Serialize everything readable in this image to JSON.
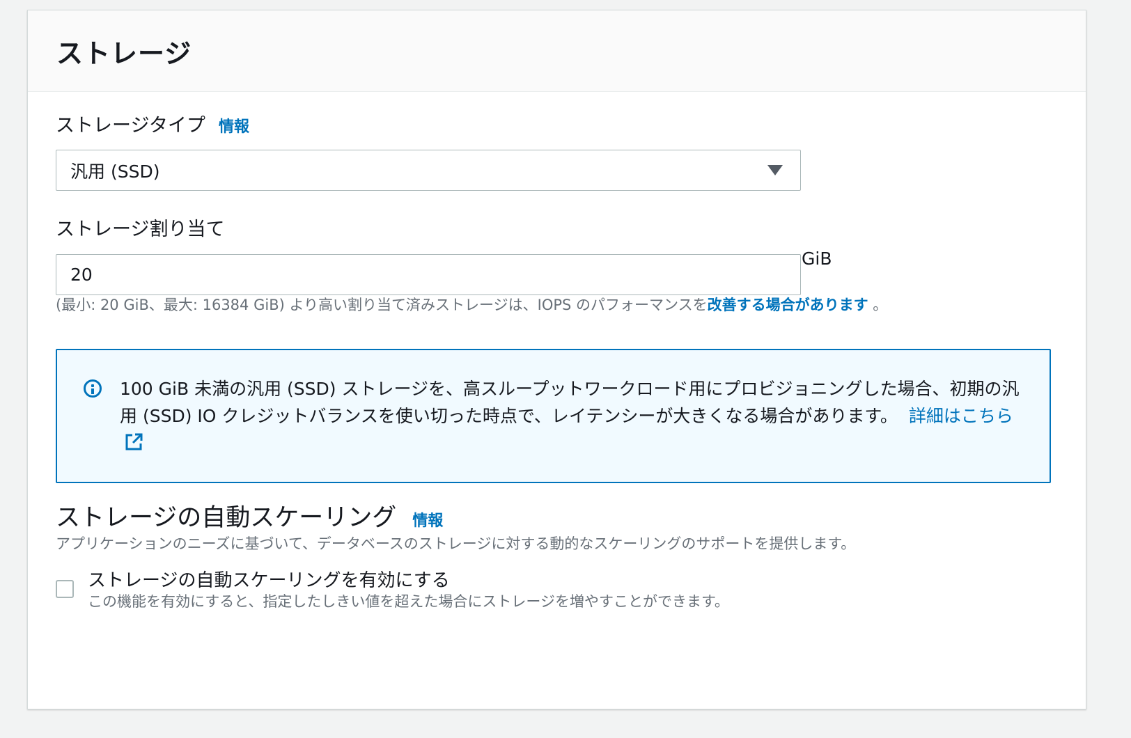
{
  "panel": {
    "title": "ストレージ"
  },
  "storage_type": {
    "label": "ストレージタイプ",
    "info_link": "情報",
    "selected_value": "汎用 (SSD)",
    "caret_icon": "caret-down-icon"
  },
  "allocation": {
    "label": "ストレージ割り当て",
    "value": "20",
    "unit": "GiB",
    "hint_prefix": "(最小: 20 GiB、最大: 16384 GiB) より高い割り当て済みストレージは、IOPS のパフォーマンスを",
    "hint_link": "改善する場合があります",
    "hint_suffix": " 。"
  },
  "alert": {
    "icon": "info-circle-icon",
    "text": "100 GiB 未満の汎用 (SSD) ストレージを、高スループットワークロード用にプロビジョニングした場合、初期の汎用 (SSD) IO クレジットバランスを使い切った時点で、レイテンシーが大きくなる場合があります。",
    "link_label": "詳細はこちら",
    "link_icon": "external-link-icon",
    "color": "#0073bb",
    "background": "#f1faff"
  },
  "autoscaling": {
    "title": "ストレージの自動スケーリング",
    "info_link": "情報",
    "description": "アプリケーションのニーズに基づいて、データベースのストレージに対する動的なスケーリングのサポートを提供します。",
    "checkbox_label": "ストレージの自動スケーリングを有効にする",
    "checkbox_checked": false,
    "checkbox_description": "この機能を有効にすると、指定したしきい値を超えた場合にストレージを増やすことができます。"
  },
  "colors": {
    "link": "#0073bb",
    "secondary_text": "#687078",
    "border": "#aab7b8"
  }
}
